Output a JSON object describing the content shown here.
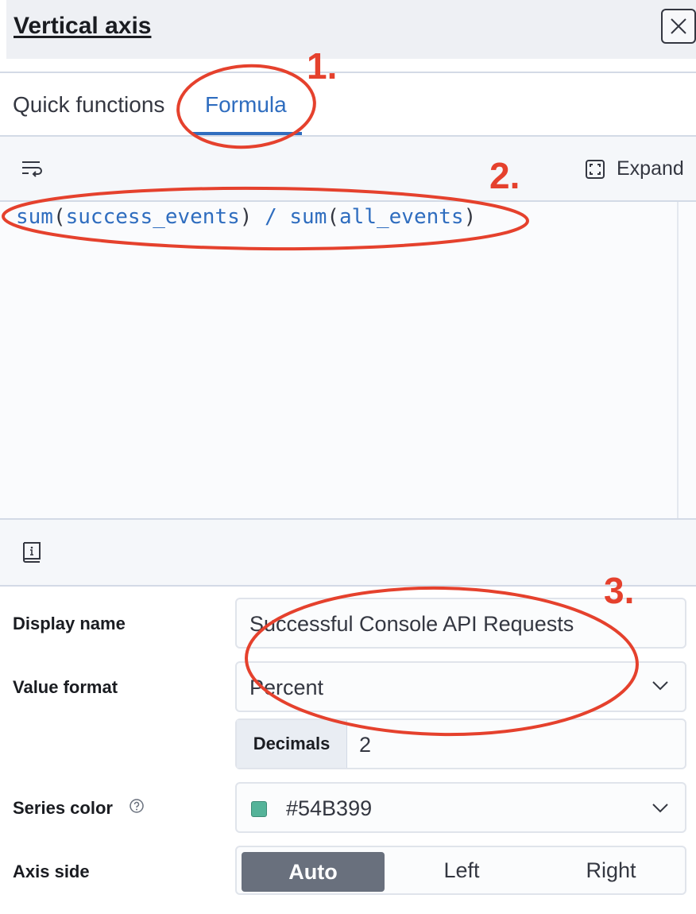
{
  "header": {
    "title": "Vertical axis",
    "close_icon": "close-icon"
  },
  "tabs": [
    {
      "label": "Quick functions",
      "selected": false
    },
    {
      "label": "Formula",
      "selected": true
    }
  ],
  "editor": {
    "wrap_icon": "word-wrap-icon",
    "expand_label": "Expand",
    "expand_icon": "expand-icon",
    "formula": {
      "fn1": "sum",
      "arg1": "success_events",
      "operator": "/",
      "fn2": "sum",
      "arg2": "all_events"
    },
    "footer_icon": "documentation-icon"
  },
  "form": {
    "display_name": {
      "label": "Display name",
      "value": "Successful Console API Requests"
    },
    "value_format": {
      "label": "Value format",
      "value": "Percent",
      "decimals_label": "Decimals",
      "decimals_value": "2"
    },
    "series_color": {
      "label": "Series color",
      "value": "#54B399",
      "color": "#54B399",
      "info_icon": "question-circle-icon"
    },
    "axis_side": {
      "label": "Axis side",
      "options": [
        "Auto",
        "Left",
        "Right"
      ],
      "selected": "Auto"
    }
  },
  "annotations": {
    "marker_1": "1.",
    "marker_2": "2.",
    "marker_3": "3.",
    "color": "#e5412d"
  },
  "colors": {
    "accent": "#2f6dbf",
    "header_bg": "#eef0f4"
  }
}
